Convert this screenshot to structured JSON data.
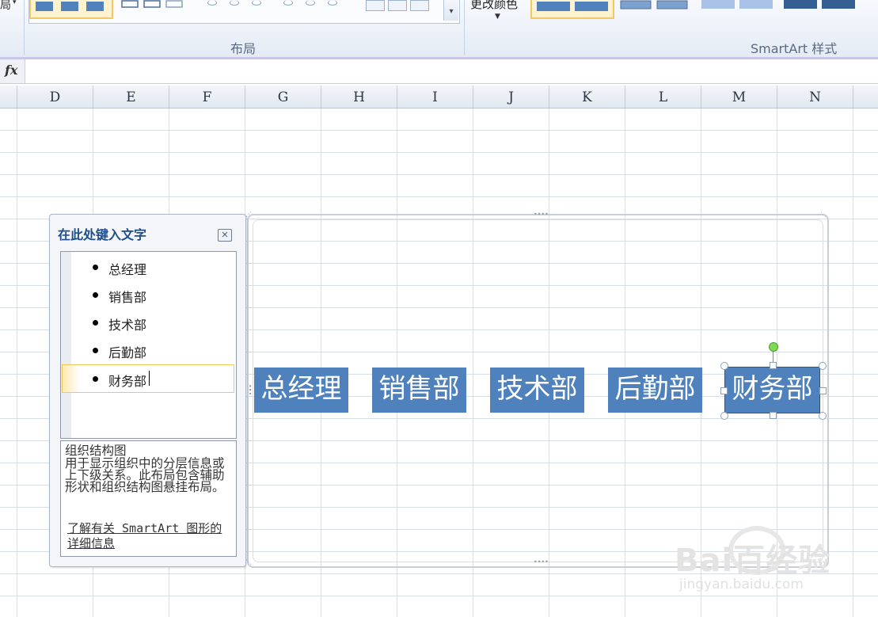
{
  "ribbon": {
    "left_cut_label": "局",
    "change_color_label": "更改颜色",
    "groups": {
      "layout_label": "布局",
      "styles_label": "SmartArt 样式"
    }
  },
  "formula_bar": {
    "fx_label": "fx"
  },
  "columns": [
    "D",
    "E",
    "F",
    "G",
    "H",
    "I",
    "J",
    "K",
    "L",
    "M",
    "N"
  ],
  "text_pane": {
    "title": "在此处键入文字",
    "close_glyph": "✕",
    "items": [
      "总经理",
      "销售部",
      "技术部",
      "后勤部",
      "财务部"
    ],
    "description": {
      "title": "组织结构图",
      "text": "用于显示组织中的分层信息或上下级关系。此布局包含辅助形状和组织结构图悬挂布局。",
      "link": "了解有关 SmartArt 图形的详细信息"
    }
  },
  "smartart": {
    "nodes": [
      "总经理",
      "销售部",
      "技术部",
      "后勤部",
      "财务部"
    ],
    "node_color": "#4f81bd",
    "selected_index": 4
  },
  "watermark": {
    "brand": "Bai百经验",
    "url": "jingyan.baidu.com"
  }
}
